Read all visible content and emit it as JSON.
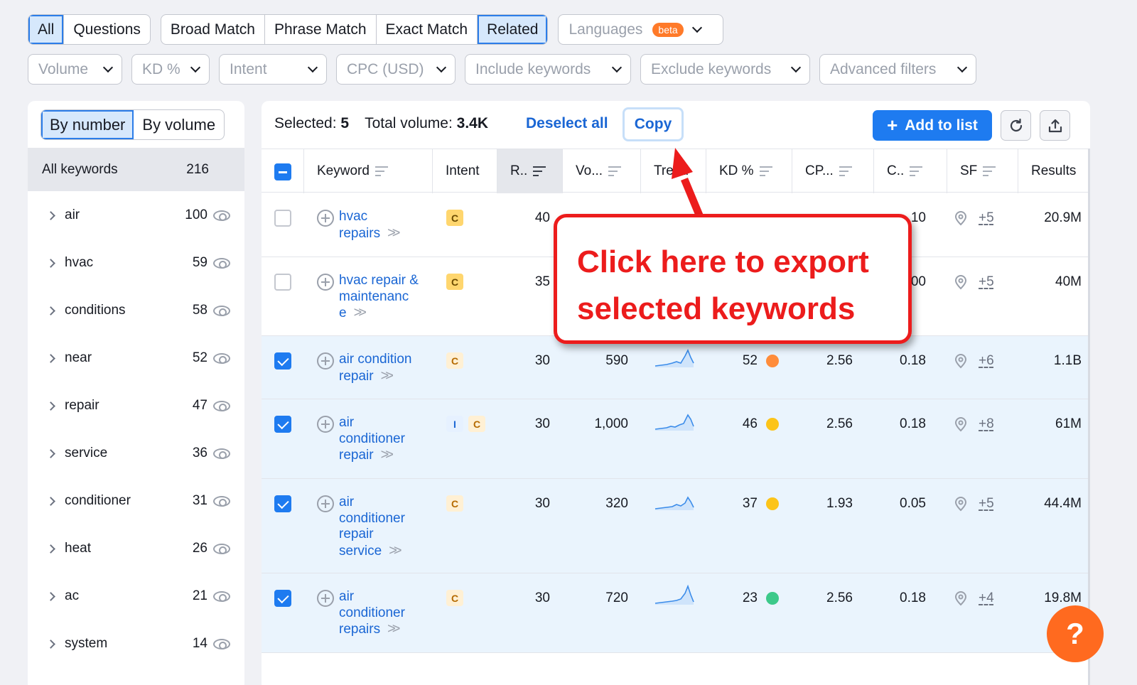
{
  "tabs_type": [
    "All",
    "Questions"
  ],
  "tabs_match": [
    "Broad Match",
    "Phrase Match",
    "Exact Match",
    "Related"
  ],
  "languages": {
    "label": "Languages",
    "badge": "beta"
  },
  "filters": [
    "Volume",
    "KD %",
    "Intent",
    "CPC (USD)",
    "Include keywords",
    "Exclude keywords",
    "Advanced filters"
  ],
  "sidebar": {
    "toggle": [
      "By number",
      "By volume"
    ],
    "all_label": "All keywords",
    "all_count": "216",
    "groups": [
      {
        "name": "air",
        "count": "100"
      },
      {
        "name": "hvac",
        "count": "59"
      },
      {
        "name": "conditions",
        "count": "58"
      },
      {
        "name": "near",
        "count": "52"
      },
      {
        "name": "repair",
        "count": "47"
      },
      {
        "name": "service",
        "count": "36"
      },
      {
        "name": "conditioner",
        "count": "31"
      },
      {
        "name": "heat",
        "count": "26"
      },
      {
        "name": "ac",
        "count": "21"
      },
      {
        "name": "system",
        "count": "14"
      }
    ]
  },
  "toolbar": {
    "selected_label": "Selected:",
    "selected_value": "5",
    "total_label": "Total volume:",
    "total_value": "3.4K",
    "deselect": "Deselect all",
    "copy": "Copy",
    "add": "Add to list"
  },
  "columns": [
    "Keyword",
    "Intent",
    "R..",
    "Vo...",
    "Trend",
    "KD %",
    "CP...",
    "C..",
    "SF",
    "Results"
  ],
  "rows": [
    {
      "kw": [
        "hvac",
        "repairs"
      ],
      "intent": [
        "C"
      ],
      "pos": "40",
      "vol": "",
      "kd": "",
      "cpc": "",
      "com": ".10",
      "sf": "+5",
      "results": "20.9M",
      "checked": false
    },
    {
      "kw": [
        "hvac repair &",
        "maintenanc",
        "e"
      ],
      "intent": [
        "C"
      ],
      "pos": "35",
      "vol": "",
      "kd": "",
      "cpc": "",
      "com": "00",
      "sf": "+5",
      "results": "40M",
      "checked": false
    },
    {
      "kw": [
        "air condition",
        "repair"
      ],
      "intent": [
        "C"
      ],
      "pos": "30",
      "vol": "590",
      "kd": "52",
      "kd_color": "#ff8c3a",
      "cpc": "2.56",
      "com": "0.18",
      "sf": "+6",
      "results": "1.1B",
      "checked": true
    },
    {
      "kw": [
        "air",
        "conditioner",
        "repair"
      ],
      "intent": [
        "I",
        "C"
      ],
      "pos": "30",
      "vol": "1,000",
      "kd": "46",
      "kd_color": "#fcc419",
      "cpc": "2.56",
      "com": "0.18",
      "sf": "+8",
      "results": "61M",
      "checked": true
    },
    {
      "kw": [
        "air",
        "conditioner",
        "repair",
        "service"
      ],
      "intent": [
        "C"
      ],
      "pos": "30",
      "vol": "320",
      "kd": "37",
      "kd_color": "#fcc419",
      "cpc": "1.93",
      "com": "0.05",
      "sf": "+5",
      "results": "44.4M",
      "checked": true
    },
    {
      "kw": [
        "air",
        "conditioner",
        "repairs"
      ],
      "intent": [
        "C"
      ],
      "pos": "30",
      "vol": "720",
      "kd": "23",
      "kd_color": "#3cc98a",
      "cpc": "2.56",
      "com": "0.18",
      "sf": "+4",
      "results": "19.8M",
      "checked": true
    }
  ],
  "callout": {
    "line1": "Click here to export",
    "line2": "selected keywords",
    "color": "#ec1c1c"
  },
  "help": "?"
}
